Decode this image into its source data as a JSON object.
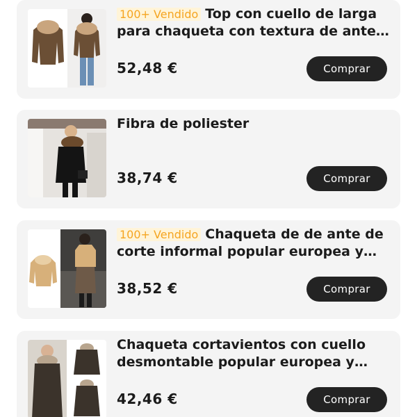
{
  "products": [
    {
      "badge": "100+ Vendido",
      "title": "Top con cuello de larga para chaqueta con textura de ante a...",
      "price": "52,48 €",
      "button": "Comprar"
    },
    {
      "badge": "",
      "title": "Fibra de poliester",
      "price": "38,74 €",
      "button": "Comprar"
    },
    {
      "badge": "100+ Vendido",
      "title": "Chaqueta de de ante de corte informal popular europea y a...",
      "price": "38,52 €",
      "button": "Comprar"
    },
    {
      "badge": "",
      "title": "Chaqueta cortavientos con cuello desmontable popular europea y am...",
      "price": "42,46 €",
      "button": "Comprar"
    }
  ],
  "colors": {
    "card_bg": "#f4f4f4",
    "badge_text": "#f5a521",
    "button_bg": "#232323"
  }
}
